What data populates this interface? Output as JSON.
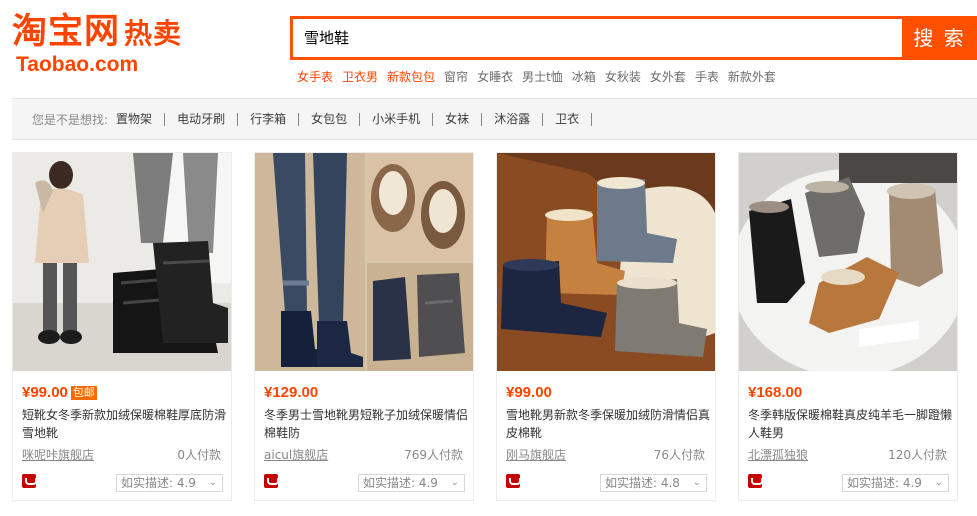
{
  "logo": {
    "cn": "淘宝网",
    "hot": "热卖",
    "en": "Taobao.com"
  },
  "search": {
    "value": "雪地鞋",
    "button": "搜 索"
  },
  "hot_words": [
    {
      "text": "女手表",
      "red": true
    },
    {
      "text": "卫衣男",
      "red": true
    },
    {
      "text": "新款包包",
      "red": true
    },
    {
      "text": "窗帘",
      "red": false
    },
    {
      "text": "女睡衣",
      "red": false
    },
    {
      "text": "男士t恤",
      "red": false
    },
    {
      "text": "冰箱",
      "red": false
    },
    {
      "text": "女秋装",
      "red": false
    },
    {
      "text": "女外套",
      "red": false
    },
    {
      "text": "手表",
      "red": false
    },
    {
      "text": "新款外套",
      "red": false
    }
  ],
  "suggest": {
    "label": "您是不是想找:",
    "items": [
      "置物架",
      "电动牙刷",
      "行李箱",
      "女包包",
      "小米手机",
      "女袜",
      "沐浴露",
      "卫衣"
    ]
  },
  "products": [
    {
      "price": "¥99.00",
      "postage": "包邮",
      "title": "短靴女冬季新款加绒保暖棉鞋厚底防滑雪地靴",
      "shop": "咪呢咔旗舰店",
      "sales": "0人付款",
      "rating": "如实描述: 4.9"
    },
    {
      "price": "¥129.00",
      "postage": "",
      "title": "冬季男士雪地靴男短靴子加绒保暖情侣棉鞋防",
      "shop": "aicul旗舰店",
      "sales": "769人付款",
      "rating": "如实描述: 4.9"
    },
    {
      "price": "¥99.00",
      "postage": "",
      "title": "雪地靴男新款冬季保暖加绒防滑情侣真皮棉靴",
      "shop": "刚马旗舰店",
      "sales": "76人付款",
      "rating": "如实描述: 4.8"
    },
    {
      "price": "¥168.00",
      "postage": "",
      "title": "冬季韩版保暖棉鞋真皮纯羊毛一脚蹬懒人鞋男",
      "shop": "北漂孤独狼",
      "sales": "120人付款",
      "rating": "如实描述: 4.9"
    }
  ]
}
